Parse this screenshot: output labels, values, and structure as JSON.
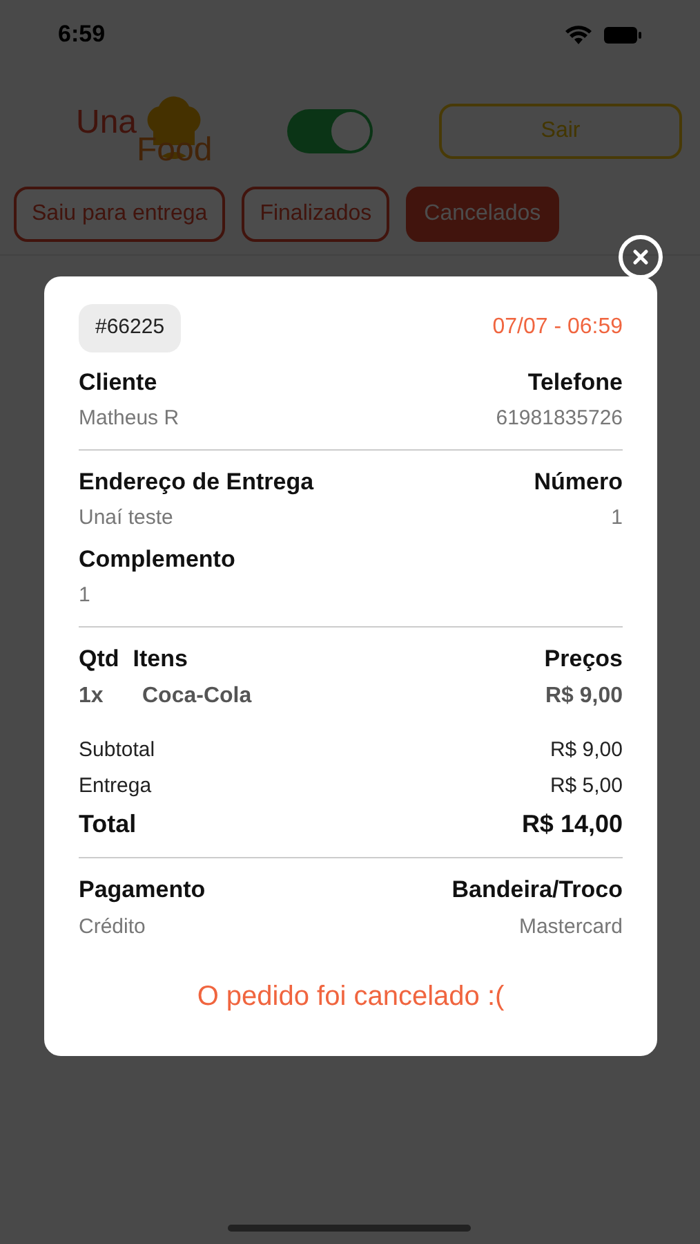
{
  "status_bar": {
    "time": "6:59"
  },
  "header": {
    "logo": {
      "line_1": "Una",
      "line_2": "Food"
    },
    "online_switch": {
      "on": true
    },
    "logout_button": "Sair"
  },
  "tabs": [
    {
      "label": "Saiu para entrega",
      "selected": false
    },
    {
      "label": "Finalizados",
      "selected": false
    },
    {
      "label": "Cancelados",
      "selected": true
    }
  ],
  "order_modal": {
    "order_number": "#66225",
    "datetime": "07/07 - 06:59",
    "customer": {
      "label": "Cliente",
      "value": "Matheus R",
      "phone_label": "Telefone",
      "phone": "61981835726"
    },
    "address": {
      "label": "Endereço de Entrega",
      "value": "Unaí teste",
      "number_label": "Número",
      "number": "1",
      "complement_label": "Complemento",
      "complement": "1"
    },
    "items_header": {
      "qty": "Qtd",
      "items": "Itens",
      "prices": "Preços"
    },
    "items": [
      {
        "qty": "1x",
        "name": "Coca-Cola",
        "price": "R$ 9,00"
      }
    ],
    "totals": [
      {
        "kind": "line",
        "label": "Subtotal",
        "value": "R$ 9,00"
      },
      {
        "kind": "line",
        "label": "Entrega",
        "value": "R$ 5,00"
      },
      {
        "kind": "grand",
        "label": "Total",
        "value": "R$ 14,00"
      }
    ],
    "payment": {
      "label": "Pagamento",
      "value": "Crédito",
      "brand_label": "Bandeira/Troco",
      "brand": "Mastercard"
    },
    "message": "O pedido foi cancelado :("
  }
}
